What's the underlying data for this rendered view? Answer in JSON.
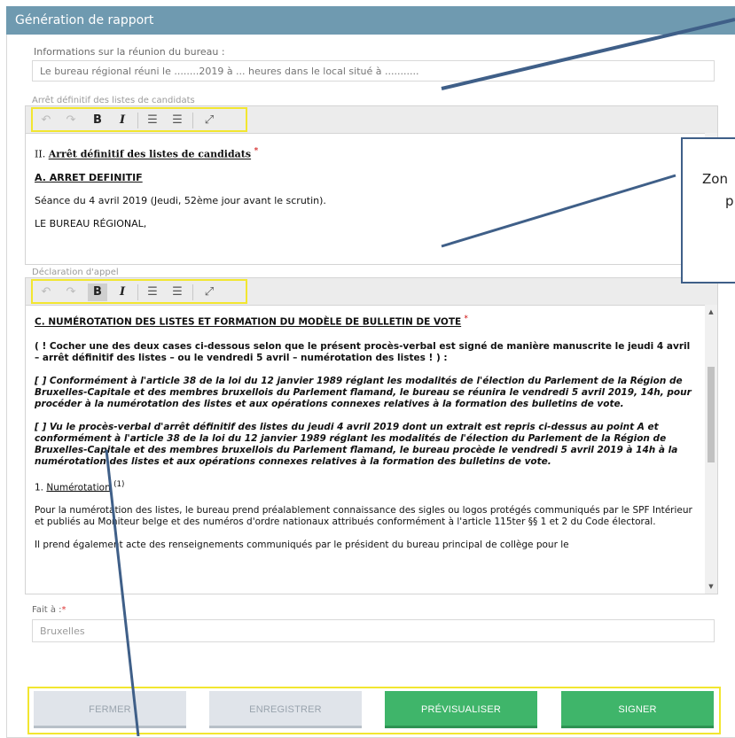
{
  "window": {
    "title": "Génération de rapport"
  },
  "meeting": {
    "label": "Informations sur la réunion du bureau :",
    "placeholder": "Le bureau régional réuni le ........2019 à ... heures dans le local situé à ..........."
  },
  "editor1": {
    "label": "Arrêt définitif des listes de candidats",
    "title_prefix": "II. ",
    "title": "Arrêt définitif des listes de candidats",
    "asterisk": "*",
    "heading": "A. ARRET DEFINITIF",
    "line1": "Séance du 4 avril 2019 (Jeudi, 52ème jour avant le scrutin).",
    "line2": "LE BUREAU RÉGIONAL,"
  },
  "editor2": {
    "label": "Déclaration d'appel",
    "heading": "C. NUMÉROTATION DES LISTES ET FORMATION DU MODÈLE DE BULLETIN DE VOTE",
    "asterisk": "*",
    "note": "( ! Cocher une des deux cases ci-dessous selon que le présent procès-verbal est signé de manière manuscrite le jeudi 4 avril – arrêt définitif des listes – ou le vendredi 5 avril – numérotation des listes ! ) :",
    "option1": "[   ] Conformément à l'article 38 de la loi du 12 janvier 1989 réglant les modalités de l'élection du Parlement de la Région de Bruxelles-Capitale et des membres bruxellois du Parlement flamand, le bureau se réunira le vendredi 5 avril 2019, 14h, pour procéder à la numérotation des listes et aux opérations connexes relatives à la formation des bulletins de vote.",
    "option2": "[   ] Vu le procès-verbal d'arrêt définitif des listes du jeudi 4 avril 2019 dont un extrait est repris ci-dessus au point A et conformément à l'article 38 de la loi du 12 janvier 1989 réglant les modalités de l'élection du Parlement de la Région de Bruxelles-Capitale et des membres bruxellois du Parlement flamand, le bureau procède le vendredi 5 avril 2019 à 14h à la numérotation des listes et aux opérations connexes relatives à la formation des bulletins de vote.",
    "sub_num": "1. ",
    "sub_title": "Numérotation",
    "sub_sup": "(1)",
    "para1": "Pour la numérotation des listes, le bureau prend préalablement connaissance des sigles ou logos protégés communiqués par le SPF Intérieur et publiés au Moniteur belge et des numéros d'ordre nationaux attribués conformément à l'article 115ter §§ 1 et 2 du Code électoral.",
    "para2": "Il prend également acte des renseignements communiqués par le président du bureau principal de collège pour le"
  },
  "toolbar": {
    "undo_icon": "↶",
    "redo_icon": "↷",
    "bold": "B",
    "italic": "I",
    "bullet_icon": "☰",
    "number_icon": "☰",
    "fullscreen_icon": "⤢"
  },
  "place": {
    "label": "Fait à :",
    "required": "*",
    "value": "Bruxelles"
  },
  "buttons": {
    "close": "FERMER",
    "save": "ENREGISTRER",
    "preview": "PRÉVISUALISER",
    "sign": "SIGNER"
  },
  "callout": {
    "text1": "Zon",
    "text2": "p"
  },
  "colors": {
    "titlebar": "#6f9ab0",
    "green": "#3fb56a",
    "highlight": "#f2e630",
    "annotation": "#3f5f88"
  }
}
